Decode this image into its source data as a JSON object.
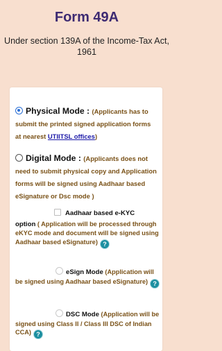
{
  "header": {
    "title": "Form 49A",
    "subtitle": "Under section 139A of the Income-Tax Act, 1961"
  },
  "options": {
    "physical": {
      "label": "Physical Mode",
      "sep": " : ",
      "desc": "(Applicants has to submit the printed signed application forms at nearest ",
      "link": "UTIITSL offices",
      "desc_end": ")",
      "selected": true
    },
    "digital": {
      "label": "Digital Mode",
      "sep": " : ",
      "desc": "(Applicants does not need to submit physical copy and Application forms will be signed using Aadhaar based eSignature or Dsc mode )",
      "selected": false
    },
    "aadhaar": {
      "label_line1": "Aadhaar based e-KYC",
      "label_line2": "option",
      "desc": " ( Application will be processed through eKYC mode and document will be signed using Aadhaar based eSignature)",
      "help": "?"
    },
    "esign": {
      "label": "eSign Mode",
      "desc": " (Application will be signed using Aadhaar based eSignature)",
      "help": "?"
    },
    "dsc": {
      "label": "DSC Mode",
      "desc": " (Application will be signed using Class II / Class III DSC of Indian CCA)",
      "help": "?"
    }
  }
}
